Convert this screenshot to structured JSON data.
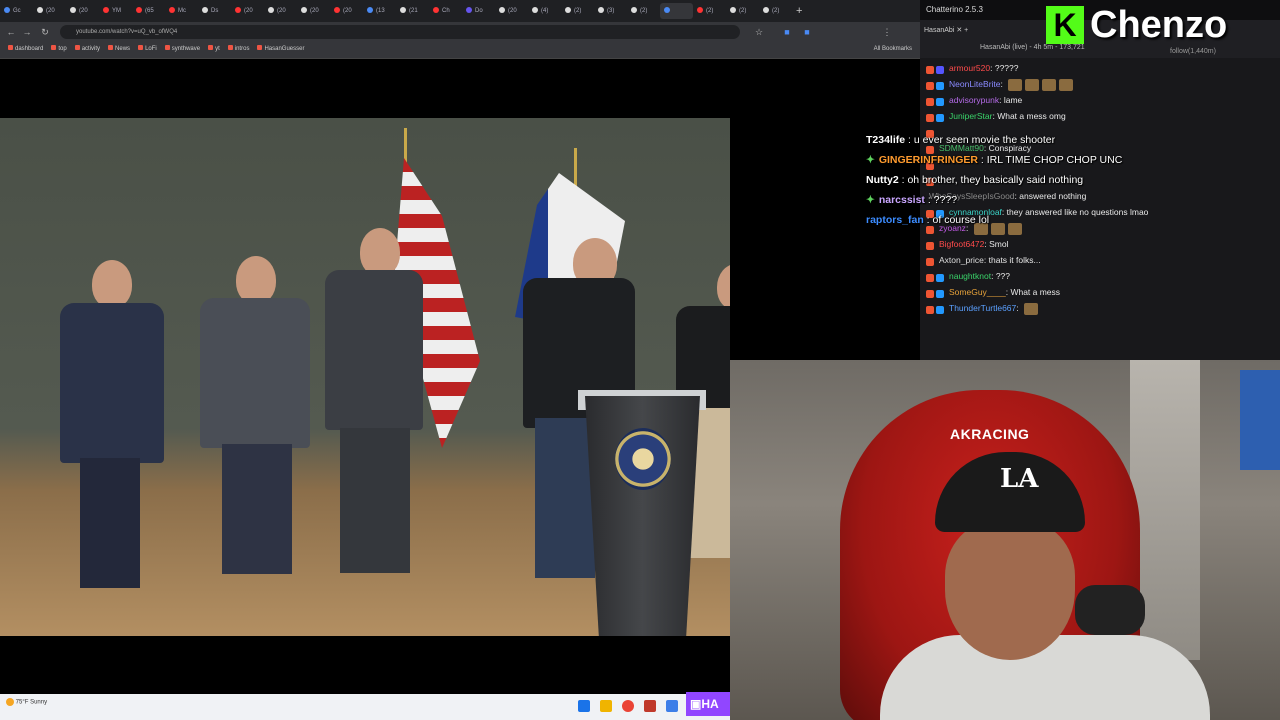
{
  "browser": {
    "tabs": [
      {
        "label": "Gc",
        "color": "#4a8af4"
      },
      {
        "label": "(20",
        "color": "#ddd"
      },
      {
        "label": "(20",
        "color": "#ddd"
      },
      {
        "label": "YM",
        "color": "#ff3333"
      },
      {
        "label": "(65",
        "color": "#ff3333"
      },
      {
        "label": "Mc",
        "color": "#ff3333"
      },
      {
        "label": "Ds",
        "color": "#ddd"
      },
      {
        "label": "(20",
        "color": "#ff3333"
      },
      {
        "label": "(20",
        "color": "#ddd"
      },
      {
        "label": "(20",
        "color": "#ddd"
      },
      {
        "label": "(20",
        "color": "#ff3333"
      },
      {
        "label": "(13",
        "color": "#4a8af4"
      },
      {
        "label": "(21",
        "color": "#ddd"
      },
      {
        "label": "Ch",
        "color": "#ff3333"
      },
      {
        "label": "Do",
        "color": "#6655ee"
      },
      {
        "label": "(20",
        "color": "#ddd"
      },
      {
        "label": "(4)",
        "color": "#ddd"
      },
      {
        "label": "(2)",
        "color": "#ddd"
      },
      {
        "label": "(3)",
        "color": "#ddd"
      },
      {
        "label": "(2)",
        "color": "#ddd"
      },
      {
        "label": "",
        "color": "#4a8af4",
        "active": true
      },
      {
        "label": "(2)",
        "color": "#ff3333"
      },
      {
        "label": "(2)",
        "color": "#ddd"
      },
      {
        "label": "(2)",
        "color": "#ddd"
      }
    ],
    "new_tab": "+",
    "window_controls": {
      "minimize": "—",
      "maximize": "▢",
      "close": "✕"
    },
    "url": "youtube.com/watch?v=uQ_vb_ofWQ4",
    "bookmarks": [
      "dashboard",
      "top",
      "activity",
      "News",
      "LoFi",
      "synthwave",
      "yt",
      "intros",
      "HasanGuesser"
    ],
    "all_bookmarks": "All Bookmarks"
  },
  "chat_app": {
    "title": "Chatterino 2.5.3",
    "tab_label": "HasanAbi",
    "channel_info": "HasanAbi (live) - 4h 5m - 173,721",
    "followers": "follow(1,440m)",
    "messages": [
      {
        "user": "armour520",
        "text": "?????",
        "color": "#ff4b4b",
        "badges": [
          "#e53",
          "#55f"
        ]
      },
      {
        "user": "NeonLiteBrite",
        "text": "",
        "color": "#8a8aff",
        "badges": [
          "#e53",
          "#29f"
        ],
        "emotes": 4
      },
      {
        "user": "advisorypunk",
        "text": "lame",
        "color": "#b56be8",
        "badges": [
          "#e53",
          "#29f"
        ]
      },
      {
        "user": "JuniperStar",
        "text": "What a mess omg",
        "color": "#3ad46a",
        "badges": [
          "#e53",
          "#29f"
        ]
      },
      {
        "user": "",
        "text": "",
        "color": "#888",
        "badges": [
          "#e53"
        ]
      },
      {
        "user": "SDMMatt90",
        "text": "Conspiracy",
        "color": "#4bbf6b",
        "badges": [
          "#e53"
        ]
      },
      {
        "user": "",
        "text": "",
        "color": "#888",
        "badges": [
          "#e53"
        ]
      },
      {
        "user": "",
        "text": "",
        "color": "#888",
        "badges": [
          "#e53"
        ]
      },
      {
        "user": "WhoSaysSleepIsGood",
        "text": "answered nothing",
        "color": "#888",
        "badges": []
      },
      {
        "user": "cynnamonloaf",
        "text": "they answered like no questions lmao",
        "color": "#3ad4c8",
        "badges": [
          "#e53",
          "#29f"
        ]
      },
      {
        "user": "zyoanz",
        "text": "",
        "color": "#c35be8",
        "badges": [
          "#e53"
        ],
        "emotes": 3
      },
      {
        "user": "Bigfoot6472",
        "text": "Smol",
        "color": "#ff4b4b",
        "badges": [
          "#e53"
        ]
      },
      {
        "user": "Axton_price",
        "text": "thats it folks...",
        "color": "#dddddd",
        "badges": [
          "#e53"
        ]
      },
      {
        "user": "naughtknot",
        "text": "???",
        "color": "#3ad46a",
        "badges": [
          "#e53",
          "#29f"
        ]
      },
      {
        "user": "SomeGuy____",
        "text": "What a mess",
        "color": "#e8a33a",
        "badges": [
          "#e53",
          "#29f"
        ]
      },
      {
        "user": "ThunderTurtle667",
        "text": "",
        "color": "#5ba0ff",
        "badges": [
          "#e53",
          "#29f"
        ],
        "emotes": 1
      }
    ]
  },
  "overlay_chat": [
    {
      "user": "T234life",
      "text": "u ever seen movie the shooter",
      "color": "#ffffff",
      "icon": ""
    },
    {
      "user": "GINGERINFRINGER",
      "text": "IRL TIME CHOP CHOP UNC",
      "color": "#ff9b2e",
      "icon": "✦"
    },
    {
      "user": "Nutty2",
      "text": "oh brother, they basically said nothing",
      "color": "#ffffff",
      "icon": ""
    },
    {
      "user": "narcssist",
      "text": "????",
      "color": "#c9a6ff",
      "icon": "✦"
    },
    {
      "user": "raptors_fan",
      "text": "of course lol",
      "color": "#3c8cff",
      "icon": ""
    }
  ],
  "logo": {
    "badge": "K",
    "text": "Chenzo"
  },
  "webcam": {
    "chair_brand": "AKRACING",
    "cap_logo": "LA"
  },
  "taskbar": {
    "weather": "75°F Sunny"
  },
  "twitch_badge": "HA"
}
